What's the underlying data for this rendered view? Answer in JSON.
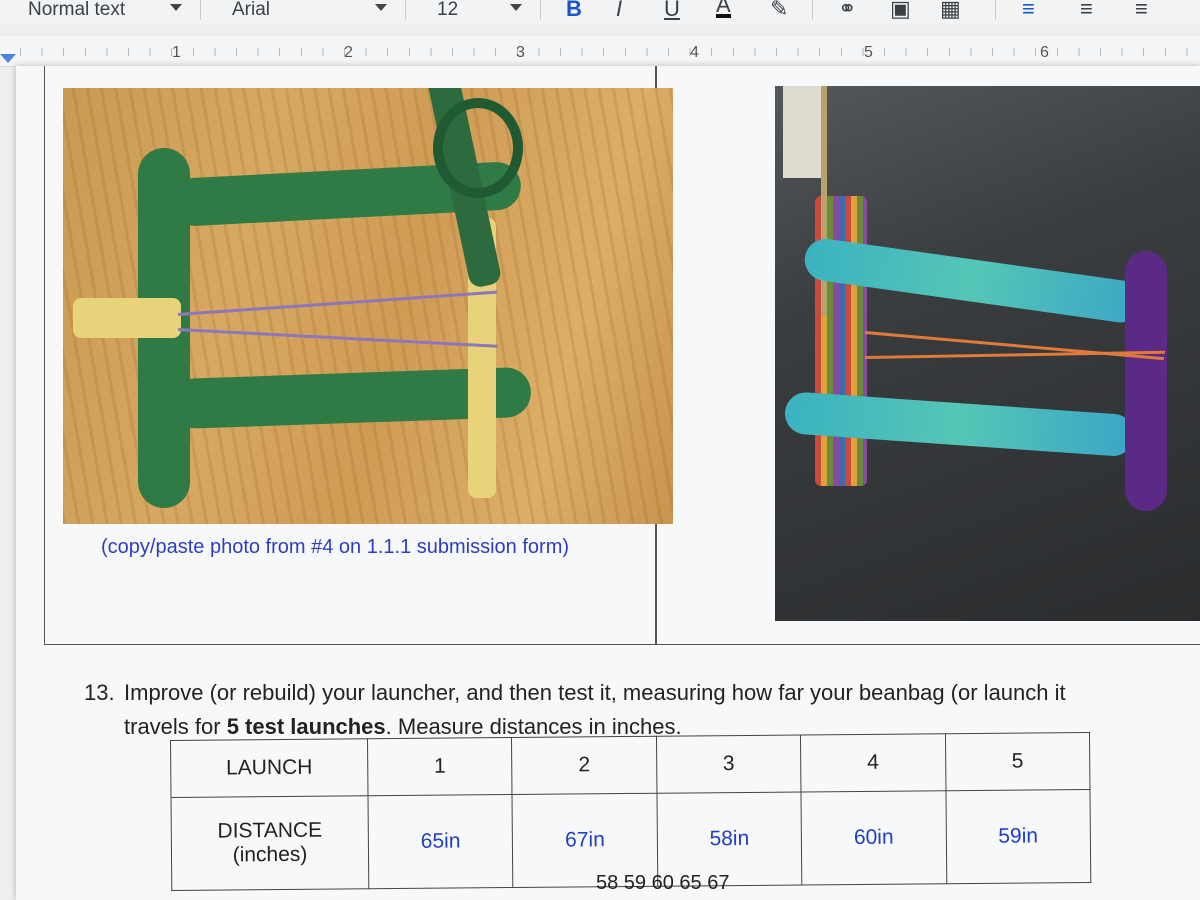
{
  "toolbar": {
    "style": "Normal text",
    "font": "Arial",
    "size": "12",
    "bold": "B",
    "italic": "I",
    "underline": "U",
    "text_color": "A",
    "icons": [
      "pencil-icon",
      "link-icon",
      "comment-icon",
      "image-icon",
      "align-left-icon",
      "align-center-icon",
      "align-right-icon"
    ]
  },
  "ruler": {
    "marks": [
      "1",
      "2",
      "3",
      "4",
      "5",
      "6"
    ]
  },
  "photo": {
    "caption": "(copy/paste photo from #4 on 1.1.1 submission form)"
  },
  "question": {
    "number": "13.",
    "line1": "Improve (or rebuild) your launcher, and then test it, measuring how far your beanbag (or launch it",
    "line2_start": "travels for ",
    "line2_bold": "5 test launches",
    "line2_end": ".  Measure distances in inches."
  },
  "table": {
    "header_label": "LAUNCH",
    "launches": [
      "1",
      "2",
      "3",
      "4",
      "5"
    ],
    "row_label_1": "DISTANCE",
    "row_label_2": "(inches)",
    "distances": [
      "65in",
      "67in",
      "58in",
      "60in",
      "59in"
    ]
  },
  "note": "58 59 60 65 67",
  "colors": {
    "accent": "#4a86e8",
    "handwritten_blue": "#1f3fc5"
  }
}
